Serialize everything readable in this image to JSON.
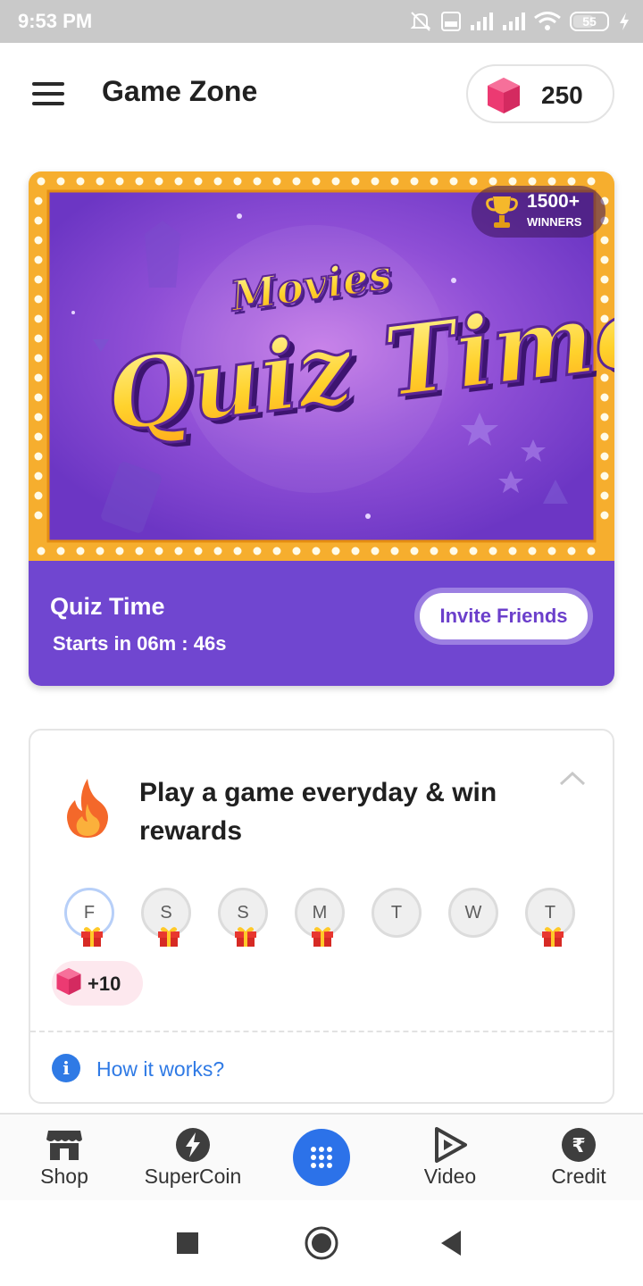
{
  "status_bar": {
    "time": "9:53 PM",
    "battery": "55",
    "icons": [
      "mute-icon",
      "volte-icon",
      "signal-icon",
      "signal-icon",
      "wifi-icon",
      "battery-icon",
      "charging-icon"
    ]
  },
  "header": {
    "title": "Game Zone",
    "menu_icon": "hamburger-menu-icon",
    "gems": "250"
  },
  "quiz_card": {
    "banner_tag": "Movies",
    "banner_title": "Quiz Time",
    "winners_count": "1500+",
    "winners_label": "WINNERS",
    "name": "Quiz Time",
    "timer": "Starts in 06m : 46s",
    "invite_label": "Invite Friends"
  },
  "rewards_card": {
    "title": "Play a game everyday & win rewards",
    "days": [
      "F",
      "S",
      "S",
      "M",
      "T",
      "W",
      "T"
    ],
    "active_day_index": 0,
    "days_with_gift": [
      0,
      1,
      2,
      3,
      6
    ],
    "reward_amount": "+10",
    "how_link": "How it works?"
  },
  "bottom_nav": {
    "items": [
      {
        "label": "Shop",
        "icon": "shop-icon"
      },
      {
        "label": "SuperCoin",
        "icon": "supercoin-icon"
      },
      {
        "label": "",
        "icon": "games-grid-icon"
      },
      {
        "label": "Video",
        "icon": "video-icon"
      },
      {
        "label": "Credit",
        "icon": "rupee-credit-icon"
      }
    ]
  },
  "colors": {
    "accent_blue": "#2c72e9",
    "quiz_purple": "#7046d0",
    "gem_pink": "#ec3a72",
    "link_blue": "#2f7ae5"
  }
}
